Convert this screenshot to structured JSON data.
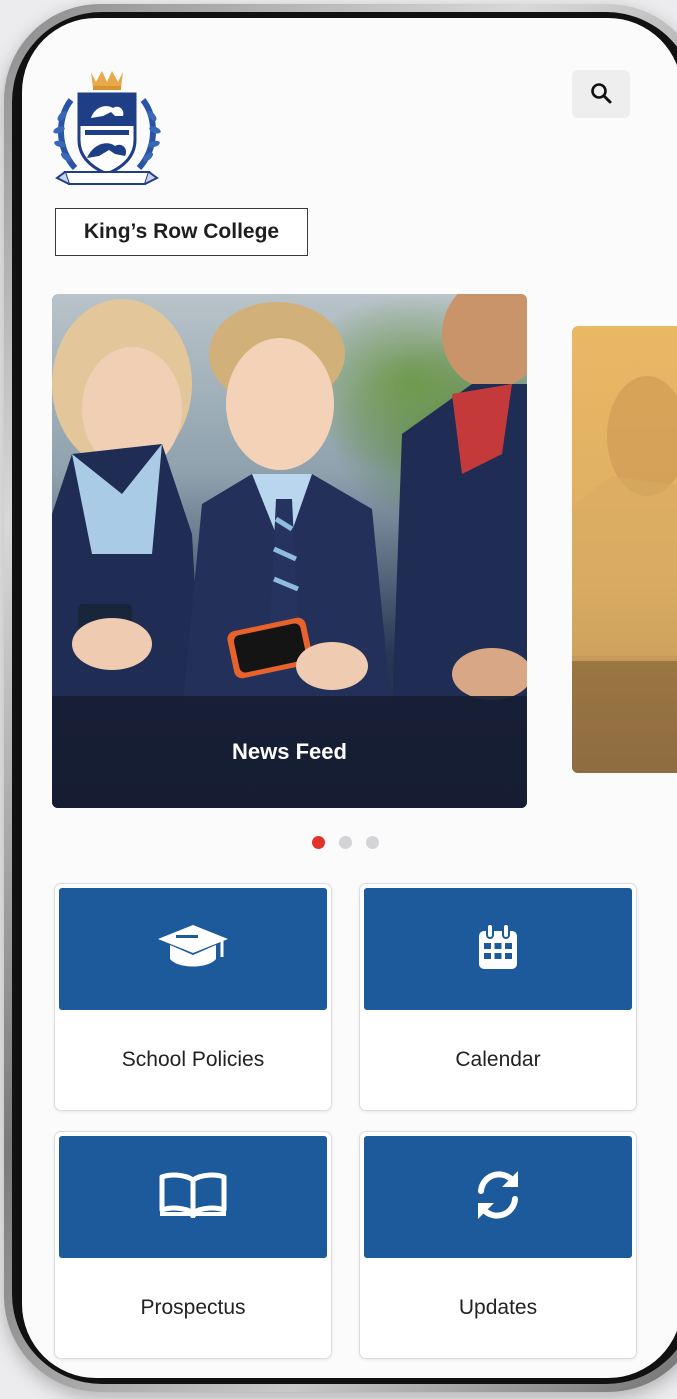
{
  "header": {
    "college_name": "King’s Row College",
    "logo_icon": "crest-logo-icon",
    "search_icon": "search-icon"
  },
  "carousel": {
    "slides": [
      {
        "label": "News Feed"
      }
    ],
    "active_index": 0,
    "dot_count": 3
  },
  "tiles": [
    {
      "label": "School Policies",
      "icon": "graduation-cap-icon"
    },
    {
      "label": "Calendar",
      "icon": "calendar-icon"
    },
    {
      "label": "Prospectus",
      "icon": "open-book-icon"
    },
    {
      "label": "Updates",
      "icon": "sync-icon"
    }
  ],
  "colors": {
    "tile_blue": "#1d5a9c",
    "dot_active": "#e0332b",
    "crest_navy": "#1e3f86",
    "crown_gold": "#e9a94a"
  }
}
